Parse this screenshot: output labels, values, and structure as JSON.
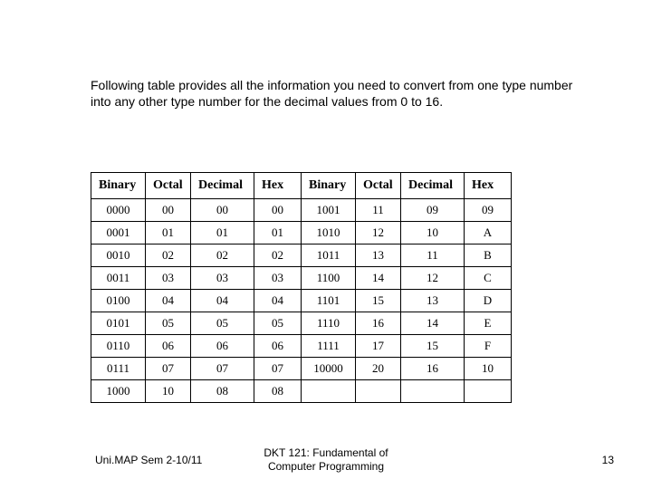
{
  "intro_text": "Following table provides all the information you need to convert from one type number into any other type number for the decimal values from 0 to 16.",
  "headers": [
    "Binary",
    "Octal",
    "Decimal",
    "Hex",
    "Binary",
    "Octal",
    "Decimal",
    "Hex"
  ],
  "rows": [
    [
      "0000",
      "00",
      "00",
      "00",
      "1001",
      "11",
      "09",
      "09"
    ],
    [
      "0001",
      "01",
      "01",
      "01",
      "1010",
      "12",
      "10",
      "A"
    ],
    [
      "0010",
      "02",
      "02",
      "02",
      "1011",
      "13",
      "11",
      "B"
    ],
    [
      "0011",
      "03",
      "03",
      "03",
      "1100",
      "14",
      "12",
      "C"
    ],
    [
      "0100",
      "04",
      "04",
      "04",
      "1101",
      "15",
      "13",
      "D"
    ],
    [
      "0101",
      "05",
      "05",
      "05",
      "1110",
      "16",
      "14",
      "E"
    ],
    [
      "0110",
      "06",
      "06",
      "06",
      "1111",
      "17",
      "15",
      "F"
    ],
    [
      "0111",
      "07",
      "07",
      "07",
      "10000",
      "20",
      "16",
      "10"
    ],
    [
      "1000",
      "10",
      "08",
      "08",
      "",
      "",
      "",
      ""
    ]
  ],
  "footer": {
    "left": "Uni.MAP Sem 2-10/11",
    "center_line1": "DKT 121: Fundamental of",
    "center_line2": "Computer Programming",
    "right": "13"
  },
  "chart_data": {
    "type": "table",
    "title": "Number-system conversion table for decimal 0 to 16",
    "columns": [
      "Binary",
      "Octal",
      "Decimal",
      "Hex"
    ],
    "series": [
      {
        "Binary": "0000",
        "Octal": "00",
        "Decimal": "00",
        "Hex": "00"
      },
      {
        "Binary": "0001",
        "Octal": "01",
        "Decimal": "01",
        "Hex": "01"
      },
      {
        "Binary": "0010",
        "Octal": "02",
        "Decimal": "02",
        "Hex": "02"
      },
      {
        "Binary": "0011",
        "Octal": "03",
        "Decimal": "03",
        "Hex": "03"
      },
      {
        "Binary": "0100",
        "Octal": "04",
        "Decimal": "04",
        "Hex": "04"
      },
      {
        "Binary": "0101",
        "Octal": "05",
        "Decimal": "05",
        "Hex": "05"
      },
      {
        "Binary": "0110",
        "Octal": "06",
        "Decimal": "06",
        "Hex": "06"
      },
      {
        "Binary": "0111",
        "Octal": "07",
        "Decimal": "07",
        "Hex": "07"
      },
      {
        "Binary": "1000",
        "Octal": "10",
        "Decimal": "08",
        "Hex": "08"
      },
      {
        "Binary": "1001",
        "Octal": "11",
        "Decimal": "09",
        "Hex": "09"
      },
      {
        "Binary": "1010",
        "Octal": "12",
        "Decimal": "10",
        "Hex": "A"
      },
      {
        "Binary": "1011",
        "Octal": "13",
        "Decimal": "11",
        "Hex": "B"
      },
      {
        "Binary": "1100",
        "Octal": "14",
        "Decimal": "12",
        "Hex": "C"
      },
      {
        "Binary": "1101",
        "Octal": "15",
        "Decimal": "13",
        "Hex": "D"
      },
      {
        "Binary": "1110",
        "Octal": "16",
        "Decimal": "14",
        "Hex": "E"
      },
      {
        "Binary": "1111",
        "Octal": "17",
        "Decimal": "15",
        "Hex": "F"
      },
      {
        "Binary": "10000",
        "Octal": "20",
        "Decimal": "16",
        "Hex": "10"
      }
    ]
  }
}
